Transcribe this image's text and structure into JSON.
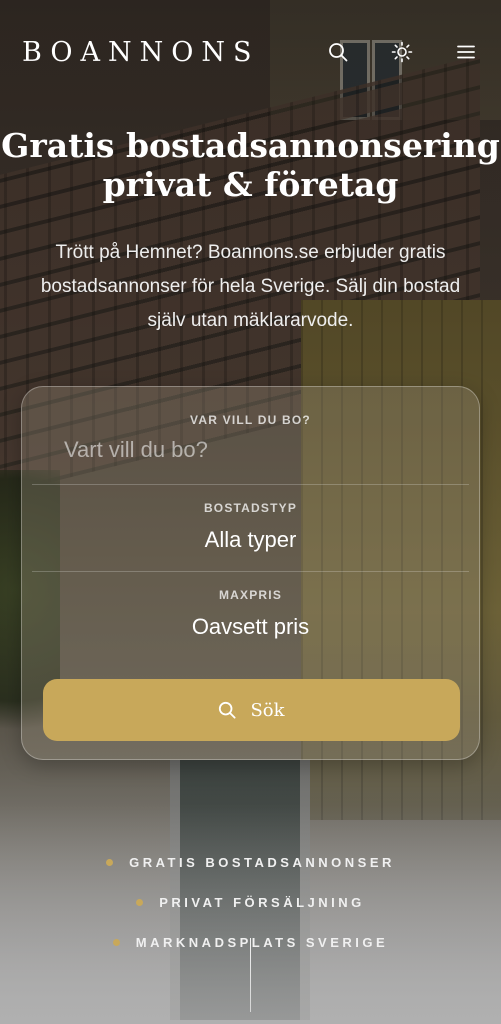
{
  "header": {
    "logo": "BOANNONS",
    "icons": [
      "search-icon",
      "theme-toggle-icon",
      "menu-icon"
    ]
  },
  "hero": {
    "title_line1": "Gratis bostadsannonsering",
    "title_line2": "privat & företag",
    "subtitle": "Trött på Hemnet? Boannons.se erbjuder gratis bostadsannonser för hela Sverige. Sälj din bostad själv utan mäklararvode."
  },
  "search": {
    "location": {
      "label": "VAR VILL DU BO?",
      "placeholder": "Vart vill du bo?"
    },
    "type": {
      "label": "BOSTADSTYP",
      "value": "Alla typer"
    },
    "price": {
      "label": "MAXPRIS",
      "value": "Oavsett pris"
    },
    "button_label": "Sök"
  },
  "features": [
    "GRATIS BOSTADSANNONSER",
    "PRIVAT FÖRSÄLJNING",
    "MARKNADSPLATS SVERIGE"
  ],
  "colors": {
    "accent": "#c8a85a"
  }
}
